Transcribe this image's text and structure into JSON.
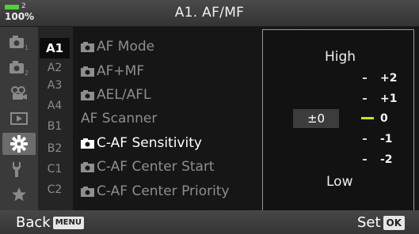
{
  "header": {
    "title": "A1. AF/MF",
    "battery": {
      "level_indicator": "2",
      "percent": "100%",
      "color": "#4fd23a"
    }
  },
  "icon_column": [
    {
      "name": "camera-1-icon",
      "sub": "1",
      "active": false
    },
    {
      "name": "camera-2-icon",
      "sub": "2",
      "active": false
    },
    {
      "name": "video-icon",
      "active": false
    },
    {
      "name": "playback-icon",
      "active": false
    },
    {
      "name": "gear-icon",
      "active": true
    },
    {
      "name": "wrench-icon",
      "active": false
    },
    {
      "name": "star-icon",
      "active": false
    }
  ],
  "tabs": [
    {
      "label": "A1",
      "active": true
    },
    {
      "label": "A2"
    },
    {
      "label": "A3"
    },
    {
      "label": "A4"
    },
    {
      "label": "B1"
    },
    {
      "label": "B2"
    },
    {
      "label": "C1"
    },
    {
      "label": "C2"
    }
  ],
  "menu_items": [
    {
      "label": "AF Mode",
      "camera_icon": true,
      "active": false
    },
    {
      "label": "AF+MF",
      "camera_icon": true,
      "active": false
    },
    {
      "label": "AEL/AFL",
      "camera_icon": true,
      "active": false
    },
    {
      "label": "AF Scanner",
      "camera_icon": false,
      "active": false
    },
    {
      "label": "C-AF Sensitivity",
      "camera_icon": true,
      "active": true
    },
    {
      "label": "C-AF Center Start",
      "camera_icon": true,
      "active": false
    },
    {
      "label": "C-AF Center Priority",
      "camera_icon": true,
      "active": false
    }
  ],
  "panel": {
    "high_label": "High",
    "low_label": "Low",
    "current_value": "±0",
    "scale": [
      {
        "value": "+2",
        "selected": false
      },
      {
        "value": "+1",
        "selected": false
      },
      {
        "value": "0",
        "selected": true
      },
      {
        "value": "-1",
        "selected": false
      },
      {
        "value": "-2",
        "selected": false
      }
    ],
    "accent_color": "#c9df2e"
  },
  "footer": {
    "back_label": "Back",
    "back_key": "MENU",
    "set_label": "Set",
    "set_key": "OK"
  }
}
